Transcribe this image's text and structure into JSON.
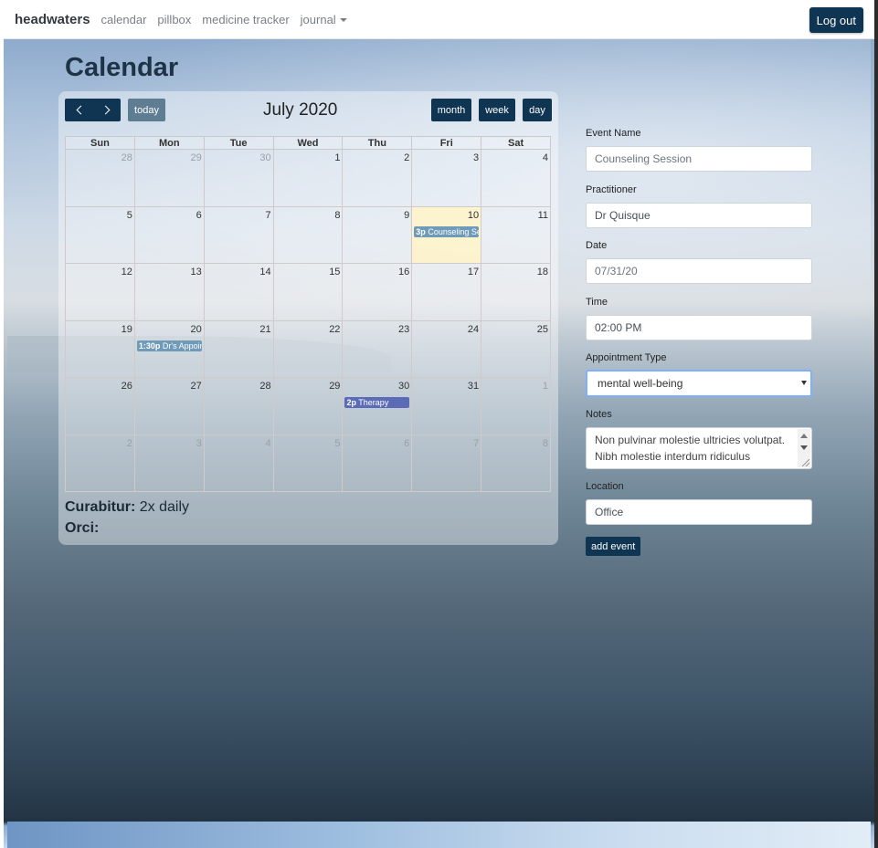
{
  "nav": {
    "brand": "headwaters",
    "links": [
      "calendar",
      "pillbox",
      "medicine tracker"
    ],
    "journal": "journal",
    "logout": "Log out"
  },
  "page_title": "Calendar",
  "calendar": {
    "title": "July 2020",
    "today_label": "today",
    "views": [
      "month",
      "week",
      "day"
    ],
    "dow": [
      "Sun",
      "Mon",
      "Tue",
      "Wed",
      "Thu",
      "Fri",
      "Sat"
    ],
    "weeks": [
      [
        {
          "n": "28",
          "o": true
        },
        {
          "n": "29",
          "o": true
        },
        {
          "n": "30",
          "o": true
        },
        {
          "n": "1"
        },
        {
          "n": "2"
        },
        {
          "n": "3"
        },
        {
          "n": "4"
        }
      ],
      [
        {
          "n": "5"
        },
        {
          "n": "6"
        },
        {
          "n": "7"
        },
        {
          "n": "8"
        },
        {
          "n": "9"
        },
        {
          "n": "10",
          "today": true,
          "event": {
            "time": "3p",
            "title": "Counseling Session",
            "color": "#6f9ab8"
          }
        },
        {
          "n": "11"
        }
      ],
      [
        {
          "n": "12"
        },
        {
          "n": "13"
        },
        {
          "n": "14"
        },
        {
          "n": "15"
        },
        {
          "n": "16"
        },
        {
          "n": "17"
        },
        {
          "n": "18"
        }
      ],
      [
        {
          "n": "19"
        },
        {
          "n": "20",
          "event": {
            "time": "1:30p",
            "title": "Dr's Appointment",
            "color": "#6f9ab8"
          }
        },
        {
          "n": "21"
        },
        {
          "n": "22"
        },
        {
          "n": "23"
        },
        {
          "n": "24"
        },
        {
          "n": "25"
        }
      ],
      [
        {
          "n": "26"
        },
        {
          "n": "27"
        },
        {
          "n": "28"
        },
        {
          "n": "29"
        },
        {
          "n": "30",
          "event": {
            "time": "2p",
            "title": "Therapy",
            "color": "#5c6bb5"
          }
        },
        {
          "n": "31"
        },
        {
          "n": "1",
          "o": true
        }
      ],
      [
        {
          "n": "2",
          "o": true
        },
        {
          "n": "3",
          "o": true
        },
        {
          "n": "4",
          "o": true
        },
        {
          "n": "5",
          "o": true
        },
        {
          "n": "6",
          "o": true
        },
        {
          "n": "7",
          "o": true
        },
        {
          "n": "8",
          "o": true
        }
      ]
    ],
    "legend": {
      "item1_label": "Curabitur:",
      "item1_value": "2x daily",
      "item2_label": "Orci:"
    }
  },
  "form": {
    "event_name_label": "Event Name",
    "event_name_placeholder": "Counseling Session",
    "practitioner_label": "Practitioner",
    "practitioner_value": "Dr Quisque",
    "date_label": "Date",
    "date_placeholder": "07/31/20",
    "time_label": "Time",
    "time_value": "02:00 PM",
    "appt_type_label": "Appointment Type",
    "appt_type_value": "mental well-being",
    "notes_label": "Notes",
    "notes_value": "Non pulvinar molestie ultricies volutpat. Nibh molestie interdum ridiculus",
    "location_label": "Location",
    "location_value": "Office",
    "submit_label": "add event"
  }
}
